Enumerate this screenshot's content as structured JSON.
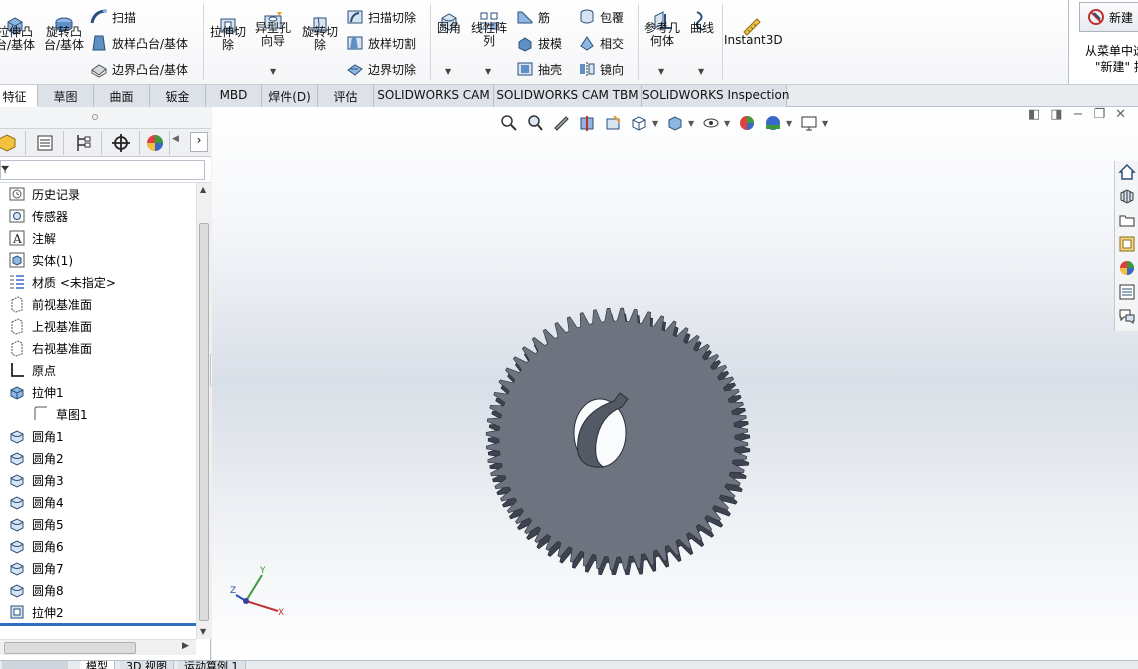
{
  "ribbon": {
    "extrude_boss": "拉伸凸\n台/基体",
    "revolve_boss": "旋转凸\n台/基体",
    "sweep": "扫描",
    "loft_boss": "放样凸台/基体",
    "boundary_boss": "边界凸台/基体",
    "extrude_cut": "拉伸切\n除",
    "hole_wizard": "异型孔\n向导",
    "revolve_cut": "旋转切\n除",
    "swept_cut": "扫描切除",
    "lofted_cut": "放样切割",
    "boundary_cut": "边界切除",
    "fillet": "圆角",
    "linear_pattern": "线性阵\n列",
    "rib": "筋",
    "draft": "拔模",
    "shell": "抽壳",
    "wrap": "包覆",
    "intersect": "相交",
    "mirror": "镜向",
    "ref_geometry": "参考几\n何体",
    "curves": "曲线",
    "instant3d": "Instant3D"
  },
  "new_panel": {
    "button_label": "新建",
    "line1": "从菜单中选",
    "line2": "\"新建\"  按"
  },
  "tabs": [
    {
      "label": "特征",
      "active": true
    },
    {
      "label": "草图"
    },
    {
      "label": "曲面"
    },
    {
      "label": "钣金"
    },
    {
      "label": "MBD"
    },
    {
      "label": "焊件(D)"
    },
    {
      "label": "评估"
    },
    {
      "label": "SOLIDWORKS CAM"
    },
    {
      "label": "SOLIDWORKS CAM TBM"
    },
    {
      "label": "SOLIDWORKS Inspection"
    }
  ],
  "tree": [
    {
      "label": "历史记录",
      "icon": "history-icon"
    },
    {
      "label": "传感器",
      "icon": "sensor-icon"
    },
    {
      "label": "注解",
      "icon": "annotation-icon"
    },
    {
      "label": "实体(1)",
      "icon": "solid-bodies-icon"
    },
    {
      "label": "材质 <未指定>",
      "icon": "material-icon"
    },
    {
      "label": "前视基准面",
      "icon": "plane-icon"
    },
    {
      "label": "上视基准面",
      "icon": "plane-icon"
    },
    {
      "label": "右视基准面",
      "icon": "plane-icon"
    },
    {
      "label": "原点",
      "icon": "origin-icon"
    },
    {
      "label": "拉伸1",
      "icon": "extrude-icon"
    },
    {
      "label": "草图1",
      "icon": "sketch-icon",
      "child": true
    },
    {
      "label": "圆角1",
      "icon": "fillet-icon"
    },
    {
      "label": "圆角2",
      "icon": "fillet-icon"
    },
    {
      "label": "圆角3",
      "icon": "fillet-icon"
    },
    {
      "label": "圆角4",
      "icon": "fillet-icon"
    },
    {
      "label": "圆角5",
      "icon": "fillet-icon"
    },
    {
      "label": "圆角6",
      "icon": "fillet-icon"
    },
    {
      "label": "圆角7",
      "icon": "fillet-icon"
    },
    {
      "label": "圆角8",
      "icon": "fillet-icon"
    },
    {
      "label": "拉伸2",
      "icon": "extrude-cut-icon"
    }
  ],
  "bottom_tabs": [
    {
      "label": "模型",
      "active": true
    },
    {
      "label": "3D 视图"
    },
    {
      "label": "运动算例 1"
    }
  ],
  "model": {
    "gear_teeth": 60,
    "gear_color": "#6e7380"
  },
  "colors": {
    "accent": "#2f6fc4",
    "tree_blue_bar": "#2f6fc4"
  }
}
